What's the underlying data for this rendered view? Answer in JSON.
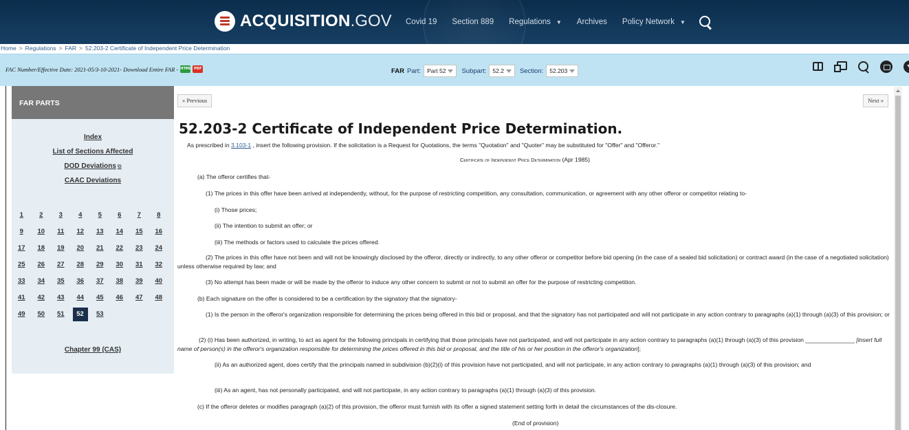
{
  "header": {
    "logo_main": "ACQUISITION",
    "logo_suffix": ".GOV",
    "nav": [
      {
        "label": "Covid 19",
        "dropdown": false
      },
      {
        "label": "Section 889",
        "dropdown": false
      },
      {
        "label": "Regulations",
        "dropdown": true
      },
      {
        "label": "Archives",
        "dropdown": false
      },
      {
        "label": "Policy Network",
        "dropdown": true
      }
    ],
    "search_icon": "search-icon"
  },
  "breadcrumb": [
    "Home",
    "Regulations",
    "FAR",
    "52.203-2 Certificate of Independent Price Determination"
  ],
  "breadcrumb_sep": ">",
  "fac_bar": {
    "label": "FAC Number/Effective Date: 2021-05/3-10-2021- Download Entire FAR -",
    "html_tag": "HTML",
    "pdf_tag": "PDF",
    "far_label": "FAR",
    "part_label": "Part:",
    "part_value": "Part 52",
    "subpart_label": "Subpart:",
    "subpart_value": "52.2",
    "section_label": "Section:",
    "section_value": "52.203",
    "tools": [
      "book-icon",
      "compare-icon",
      "search-icon",
      "print-icon",
      "download-icon"
    ]
  },
  "sidebar": {
    "heading": "FAR PARTS",
    "links": [
      "Index",
      "List of Sections Affected",
      "DOD Deviations",
      "CAAC Deviations"
    ],
    "external_glyph": "⧉",
    "parts": [
      "1",
      "2",
      "3",
      "4",
      "5",
      "6",
      "7",
      "8",
      "9",
      "10",
      "11",
      "12",
      "13",
      "14",
      "15",
      "16",
      "17",
      "18",
      "19",
      "20",
      "21",
      "22",
      "23",
      "24",
      "25",
      "26",
      "27",
      "28",
      "29",
      "30",
      "31",
      "32",
      "33",
      "34",
      "35",
      "36",
      "37",
      "38",
      "39",
      "40",
      "41",
      "42",
      "43",
      "44",
      "45",
      "46",
      "47",
      "48",
      "49",
      "50",
      "51",
      "52",
      "53"
    ],
    "active_part": "52",
    "chapter99": "Chapter 99 (CAS)"
  },
  "content": {
    "prev": "« Previous",
    "next": "Next »",
    "title": "52.203-2  Certificate of Independent Price Determination.",
    "prescribed_pre": "As prescribed in ",
    "prescribed_link": "3.103-1",
    "prescribed_post": " , insert the following provision. If the solicitation is a Request for Quotations, the terms \"Quotation\" and \"Quoter\" may be substituted for \"Offer\" and \"Offeror.\"",
    "provision_title": "Certificate of Independent Price Determination",
    "provision_date": "(Apr 1985)",
    "a": "(a)  The offeror certifies that-",
    "a1": "(1)  The prices in this offer have been arrived at independently, without, for the purpose of restricting competition, any consultation, communication, or agreement with any other offeror or competitor relating to-",
    "a1i": "(i)  Those prices;",
    "a1ii": "(ii)  The intention to submit an offer; or",
    "a1iii": "(iii)  The methods or factors used to calculate the prices offered.",
    "a2": "(2)  The prices in this offer have not been and will not be knowingly disclosed by the offeror, directly or indirectly, to any other offeror or competitor before bid opening (in the case of a sealed bid solicitation) or contract award (in the case of a negotiated solicitation) unless otherwise required by law; and",
    "a3": "(3)  No attempt has been made or will be made by the offeror to induce any other concern to submit or not to submit an offer for the purpose of restricting competition.",
    "b": "(b)  Each signature on the offer is considered to be a certification by the signatory that the signatory-",
    "b1": "(1)  Is the person in the offeror's organization responsible for determining the prices being offered in this bid or proposal, and that the signatory has not participated and will not participate in any action contrary to paragraphs (a)(1) through (a)(3) of this provision; or",
    "b2i_pre": "(2)  (i)  Has been authorized, in writing, to act as agent for the following principals in certifying that those principals have not participated, and will not participate in any action contrary to paragraphs (a)(1) through (a)(3) of this provision _______________ ",
    "b2i_italic": "[insert full name of person(s) in the offeror's organization responsible for determining the prices offered in this bid or proposal, and the title of his or her position in the offeror's organization",
    "b2i_post": "];",
    "b2ii": "(ii)  As an authorized agent, does certify that the principals named in subdivision (b)(2)(i) of this provision have not participated, and will not participate, in any action contrary to paragraphs (a)(1) through (a)(3) of this provision; and",
    "b2iii": "(iii)  As an agent, has not personally participated, and will not participate, in any action contrary to paragraphs (a)(1) through (a)(3) of this provision.",
    "c": "(c)  If the offeror deletes or modifies paragraph (a)(2) of this provision, the offeror must furnish with its offer a signed statement setting forth in detail the circumstances of the dis-closure.",
    "end": "(End of provision)"
  }
}
